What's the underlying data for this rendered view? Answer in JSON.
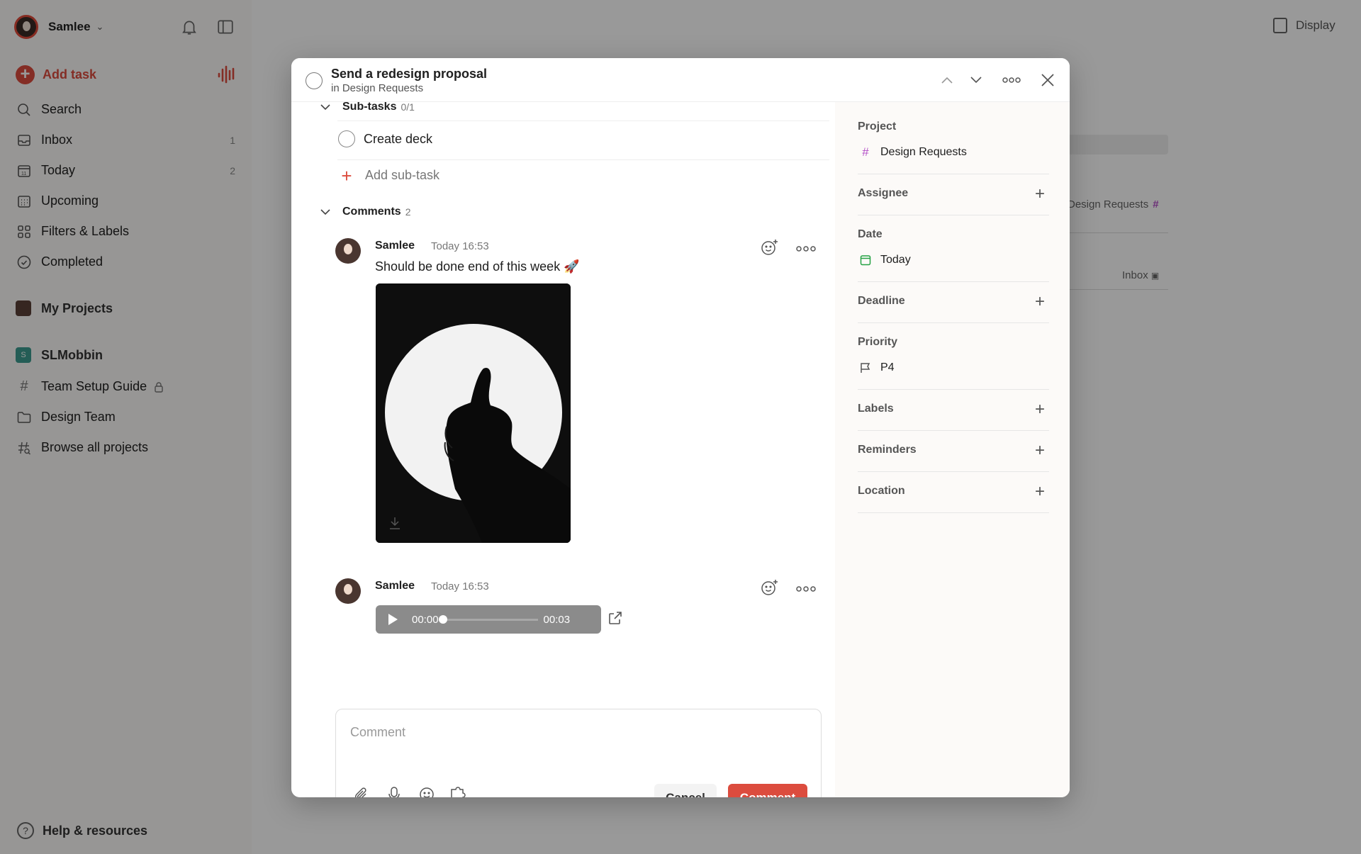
{
  "sidebar": {
    "user_name": "Samlee",
    "add_task": "Add task",
    "nav": [
      {
        "label": "Search",
        "count": ""
      },
      {
        "label": "Inbox",
        "count": "1"
      },
      {
        "label": "Today",
        "count": "2"
      },
      {
        "label": "Upcoming",
        "count": ""
      },
      {
        "label": "Filters & Labels",
        "count": ""
      },
      {
        "label": "Completed",
        "count": ""
      }
    ],
    "my_projects": "My Projects",
    "workspace": {
      "name": "SLMobbin",
      "badge": "S"
    },
    "projects": [
      {
        "label": "Team Setup Guide"
      },
      {
        "label": "Design Team"
      },
      {
        "label": "Browse all projects"
      }
    ],
    "help": "Help & resources"
  },
  "main": {
    "display": "Display",
    "bg_project": "Design Requests",
    "bg_inbox": "Inbox"
  },
  "task": {
    "title": "Send a redesign proposal",
    "subtitle": "in Design Requests",
    "subtasks_label": "Sub-tasks",
    "subtasks_count": "0/1",
    "subtasks": [
      {
        "label": "Create deck"
      }
    ],
    "add_subtask": "Add sub-task",
    "comments_label": "Comments",
    "comments_count": "2",
    "comments": [
      {
        "author": "Samlee",
        "time": "Today 16:53",
        "text": "Should be done end of this week 🚀"
      },
      {
        "author": "Samlee",
        "time": "Today 16:53",
        "audio_current": "00:00",
        "audio_total": "00:03",
        "audio_progress": 0
      }
    ],
    "composer": {
      "placeholder": "Comment",
      "cancel": "Cancel",
      "submit": "Comment"
    }
  },
  "details": {
    "project_label": "Project",
    "project_value": "Design Requests",
    "assignee_label": "Assignee",
    "date_label": "Date",
    "date_value": "Today",
    "deadline_label": "Deadline",
    "priority_label": "Priority",
    "priority_value": "P4",
    "labels_label": "Labels",
    "reminders_label": "Reminders",
    "location_label": "Location"
  },
  "colors": {
    "accent": "#dc4c3e",
    "project_hash": "#b450c8",
    "date_green": "#25a244",
    "workspace": "#3d9c8f"
  }
}
